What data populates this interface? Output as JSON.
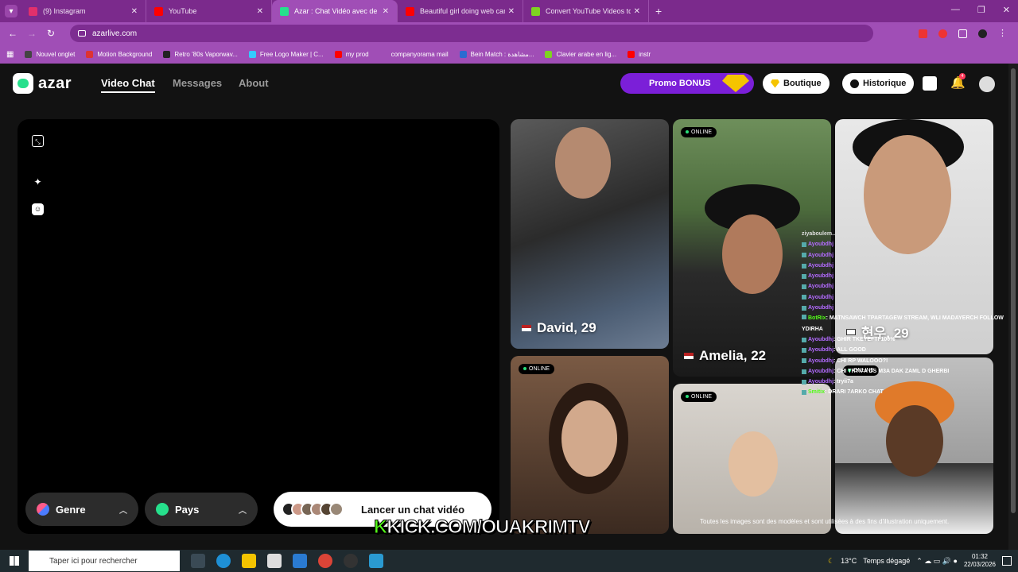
{
  "browser": {
    "tabs": [
      {
        "title": "(9) Instagram",
        "color": "#e1306c",
        "active": false
      },
      {
        "title": "YouTube",
        "color": "#ff0000",
        "active": false
      },
      {
        "title": "Azar : Chat Vidéo avec de n",
        "color": "#26e08c",
        "active": true
      },
      {
        "title": "Beautiful girl doing web cam ch",
        "color": "#ff0000",
        "active": false
      },
      {
        "title": "Convert YouTube Videos to MP",
        "color": "#7ed321",
        "active": false
      }
    ],
    "url": "azarlive.com",
    "bookmarks": [
      "Nouvel onglet",
      "Motion Background",
      "Retro '80s Vaporwav...",
      "Free Logo Maker | C...",
      "my prod",
      "companyorama mail",
      "Bein Match : مشاهدة...",
      "Clavier arabe en lig...",
      "instr"
    ]
  },
  "site": {
    "logo": "azar",
    "nav": {
      "video_chat": "Video Chat",
      "messages": "Messages",
      "about": "About"
    },
    "promo": "Promo BONUS",
    "boutique": "Boutique",
    "historique": "Historique",
    "notif_count": "4",
    "filters": {
      "genre": "Genre",
      "pays": "Pays"
    },
    "launch": "Lancer un chat vidéo",
    "online_label": "ONLINE",
    "profiles": [
      {
        "name": "David, 29"
      },
      {
        "name": "Amelia, 22"
      },
      {
        "name": "현우, 29"
      }
    ],
    "disclaimer": "Toutes les images sont des modèles et sont utilisées à des fins d'illustration uniquement."
  },
  "overlay": {
    "chat_header": "ziyaboulem...",
    "chat": [
      {
        "user": "Ayoubdhj",
        "msg": ""
      },
      {
        "user": "Ayoubdhj",
        "msg": ""
      },
      {
        "user": "Ayoubdhj",
        "msg": ""
      },
      {
        "user": "Ayoubdhj",
        "msg": ""
      },
      {
        "user": "Ayoubdhj",
        "msg": ""
      },
      {
        "user": "Ayoubdhj",
        "msg": ""
      },
      {
        "user": "Ayoubdhj",
        "msg": ""
      },
      {
        "user": "BotRix",
        "msg": ": MATNSAWCH TPARTAGEW STREAM, WLI MADAYERCH FOLLOW YDIRHA"
      },
      {
        "user": "Ayoubdhj",
        "msg": ": GHIR TKEYEFTI 100%"
      },
      {
        "user": "Ayoubdhj",
        "msg": ": ALL GOOD"
      },
      {
        "user": "Ayoubdhj",
        "msg": ": CHI RP WALOOO?!"
      },
      {
        "user": "Ayoubdhj",
        "msg": ": CHI TRYI7A DS M3A DAK ZAML D GHERBI"
      },
      {
        "user": "Ayoubdhj",
        "msg": ": tryii7a"
      },
      {
        "user": "Smitix",
        "msg": ": DRARI 7ARKO CHAT"
      }
    ],
    "kick_prefix": "K",
    "kick_text": "KICK.COM/OUAKRIMTV"
  },
  "taskbar": {
    "search": "Taper ici pour rechercher",
    "temp": "13°C",
    "weather": "Temps dégagé",
    "time": "01:32",
    "date": "22/03/2026"
  }
}
